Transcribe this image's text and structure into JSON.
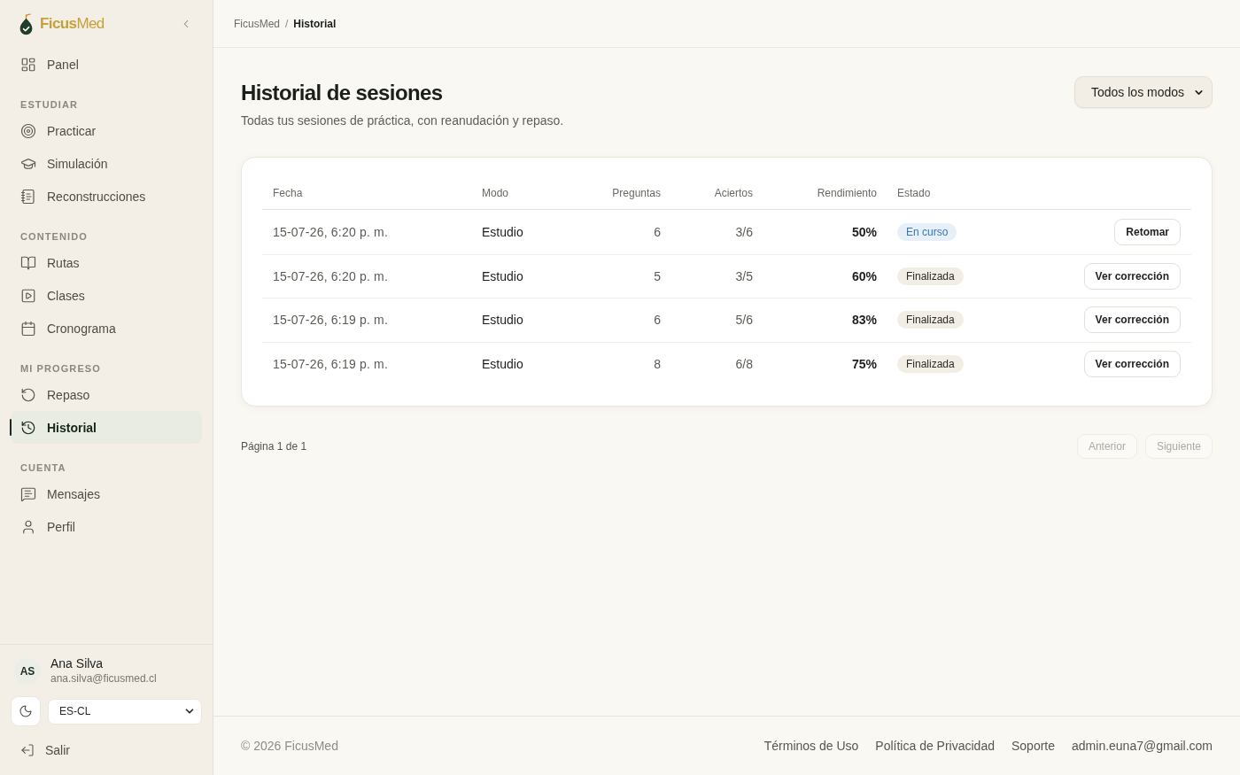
{
  "sidebar": {
    "brand": "**Ficus**Med",
    "sections": [
      {
        "items": [
          {
            "label": "Panel",
            "selected": false
          }
        ]
      },
      {
        "title": "ESTUDIAR",
        "items": [
          {
            "label": "Practicar",
            "selected": false
          },
          {
            "label": "Simulación",
            "selected": false
          },
          {
            "label": "Reconstrucciones",
            "selected": false
          }
        ]
      },
      {
        "title": "CONTENIDO",
        "items": [
          {
            "label": "Rutas",
            "selected": false
          },
          {
            "label": "Clases",
            "selected": false
          },
          {
            "label": "Cronograma",
            "selected": false
          }
        ]
      },
      {
        "title": "MI PROGRESO",
        "items": [
          {
            "label": "Repaso",
            "selected": false
          },
          {
            "label": "Historial",
            "selected": true
          }
        ]
      },
      {
        "title": "CUENTA",
        "items": [
          {
            "label": "Mensajes",
            "selected": false
          },
          {
            "label": "Perfil",
            "selected": false
          }
        ]
      }
    ],
    "user": {
      "initials": "AS",
      "name": "Ana Silva",
      "email": "ana.silva@ficusmed.cl"
    },
    "language": {
      "value": "ES-CL"
    },
    "logout": {
      "label": "Salir"
    }
  },
  "breadcrumb": {
    "separator": "/",
    "items": [
      {
        "label": "FicusMed",
        "current": false
      },
      {
        "label": "Historial",
        "current": true
      }
    ]
  },
  "page": {
    "title": "Historial de sesiones",
    "subtitle": "Todas tus sesiones de práctica, con reanudación y repaso.",
    "mode_filter": {
      "value": "Todos los modos"
    }
  },
  "table": {
    "columns": [
      "Fecha",
      "Modo",
      "Preguntas",
      "Aciertos",
      "Rendimiento",
      "Estado"
    ],
    "rows": [
      {
        "date": "15-07-26, 6:20 p. m.",
        "mode": "Estudio",
        "questions": "6",
        "correct": "3/6",
        "score": "50%",
        "status": {
          "label": "En curso",
          "kind": "in_progress"
        },
        "action": "Retomar"
      },
      {
        "date": "15-07-26, 6:20 p. m.",
        "mode": "Estudio",
        "questions": "5",
        "correct": "3/5",
        "score": "60%",
        "status": {
          "label": "Finalizada",
          "kind": "finished"
        },
        "action": "Ver corrección"
      },
      {
        "date": "15-07-26, 6:19 p. m.",
        "mode": "Estudio",
        "questions": "6",
        "correct": "5/6",
        "score": "83%",
        "status": {
          "label": "Finalizada",
          "kind": "finished"
        },
        "action": "Ver corrección"
      },
      {
        "date": "15-07-26, 6:19 p. m.",
        "mode": "Estudio",
        "questions": "8",
        "correct": "6/8",
        "score": "75%",
        "status": {
          "label": "Finalizada",
          "kind": "finished"
        },
        "action": "Ver corrección"
      }
    ]
  },
  "pagination": {
    "label": "Página 1 de 1",
    "buttons": [
      {
        "label": "Anterior",
        "disabled": true
      },
      {
        "label": "Siguiente",
        "disabled": true
      }
    ]
  },
  "footer": {
    "copyright": "© 2026 FicusMed",
    "links": [
      "Términos de Uso",
      "Política de Privacidad",
      "Soporte",
      "admin.euna7@gmail.com"
    ]
  }
}
